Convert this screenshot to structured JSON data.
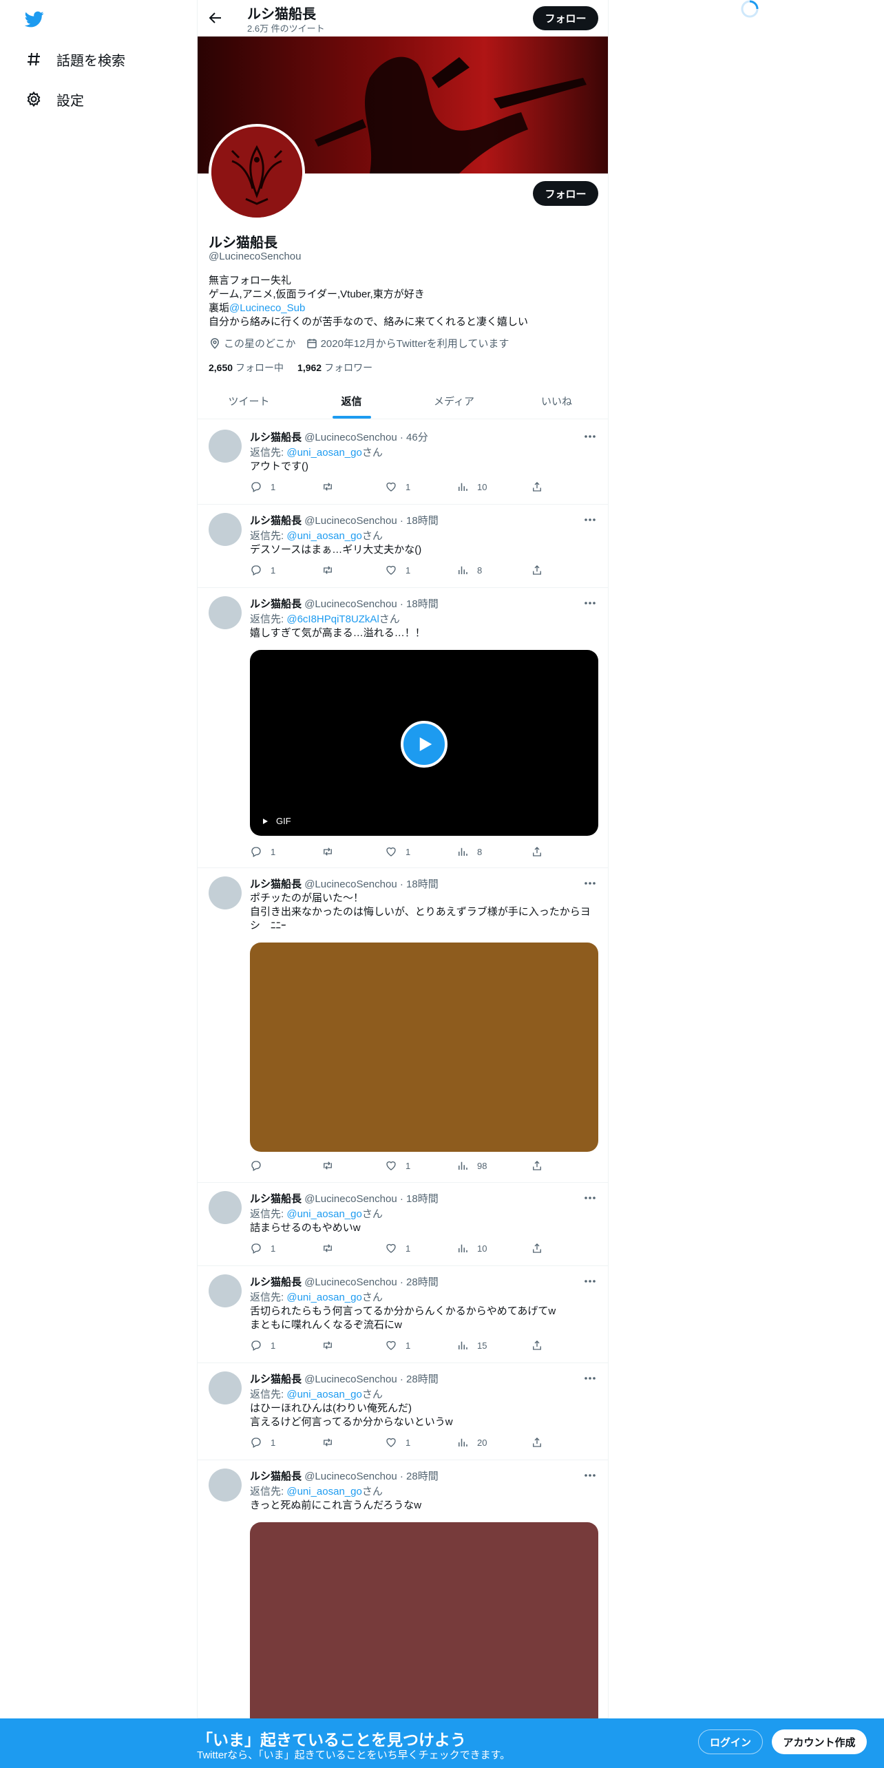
{
  "nav": {
    "explore_label": "話題を検索",
    "settings_label": "設定"
  },
  "header": {
    "name": "ルシ猫船長",
    "tweet_count": "2.6万 件のツイート",
    "follow_label": "フォロー"
  },
  "profile": {
    "name": "ルシ猫船長",
    "handle": "@LucinecoSenchou",
    "follow_label": "フォロー",
    "bio_line1": "無言フォロー失礼",
    "bio_line2": "ゲーム,アニメ,仮面ライダー,Vtuber,東方が好き",
    "bio_line3_prefix": "裏垢",
    "bio_line3_link": "@Lucineco_Sub",
    "bio_line4": "自分から絡みに行くのが苦手なので、絡みに来てくれると凄く嬉しい",
    "location": "この星のどこか",
    "joined": "2020年12月からTwitterを利用しています",
    "following_count": "2,650",
    "following_label": "フォロー中",
    "followers_count": "1,962",
    "followers_label": "フォロワー"
  },
  "tabs": [
    {
      "label": "ツイート"
    },
    {
      "label": "返信"
    },
    {
      "label": "メディア"
    },
    {
      "label": "いいね"
    }
  ],
  "reply_to_prefix": "返信先: ",
  "reply_to_suffix": "さん",
  "tweets": [
    {
      "name": "ルシ猫船長",
      "handle": "@LucinecoSenchou",
      "dot": "·",
      "time": "46分",
      "reply_to": "@uni_aosan_go",
      "text": "アウトです()",
      "replies": "1",
      "retweets": "",
      "likes": "1",
      "views": "10"
    },
    {
      "name": "ルシ猫船長",
      "handle": "@LucinecoSenchou",
      "dot": "·",
      "time": "18時間",
      "reply_to": "@uni_aosan_go",
      "text": "デスソースはまぁ…ギリ大丈夫かな()",
      "replies": "1",
      "retweets": "",
      "likes": "1",
      "views": "8"
    },
    {
      "name": "ルシ猫船長",
      "handle": "@LucinecoSenchou",
      "dot": "·",
      "time": "18時間",
      "reply_to": "@6cI8HPqiT8UZkAl",
      "text": "嬉しすぎて気が高まる…溢れる…！！",
      "media_label": "GIF",
      "replies": "1",
      "retweets": "",
      "likes": "1",
      "views": "8"
    },
    {
      "name": "ルシ猫船長",
      "handle": "@LucinecoSenchou",
      "dot": "·",
      "time": "18時間",
      "text": "ポチッたのが届いた〜！\n自引き出来なかったのは悔しいが、とりあえずラブ様が手に入ったからヨシ　ﾆﾆｰ",
      "media_color": "#8e5c1e",
      "replies": "",
      "retweets": "",
      "likes": "1",
      "views": "98"
    },
    {
      "name": "ルシ猫船長",
      "handle": "@LucinecoSenchou",
      "dot": "·",
      "time": "18時間",
      "reply_to": "@uni_aosan_go",
      "text": "詰まらせるのもやめいw",
      "replies": "1",
      "retweets": "",
      "likes": "1",
      "views": "10"
    },
    {
      "name": "ルシ猫船長",
      "handle": "@LucinecoSenchou",
      "dot": "·",
      "time": "28時間",
      "reply_to": "@uni_aosan_go",
      "text": "舌切られたらもう何言ってるか分からんくかるからやめてあげてw\nまともに喋れんくなるぞ流石にw",
      "replies": "1",
      "retweets": "",
      "likes": "1",
      "views": "15"
    },
    {
      "name": "ルシ猫船長",
      "handle": "@LucinecoSenchou",
      "dot": "·",
      "time": "28時間",
      "reply_to": "@uni_aosan_go",
      "text": "はひーほれひんは(わりい俺死んだ)\n言えるけど何言ってるか分からないというw",
      "replies": "1",
      "retweets": "",
      "likes": "1",
      "views": "20"
    },
    {
      "name": "ルシ猫船長",
      "handle": "@LucinecoSenchou",
      "dot": "·",
      "time": "28時間",
      "reply_to": "@uni_aosan_go",
      "text": "きっと死ぬ前にこれ言うんだろうなw",
      "media_color": "#773b3b"
    }
  ],
  "bottom_bar": {
    "title": "「いま」起きていることを見つけよう",
    "subtitle": "Twitterなら、「いま」起きていることをいち早くチェックできます。",
    "login_label": "ログイン",
    "signup_label": "アカウント作成"
  },
  "colors": {
    "accent": "#1d9bf0",
    "text_primary": "#0f1419",
    "text_secondary": "#536471"
  }
}
